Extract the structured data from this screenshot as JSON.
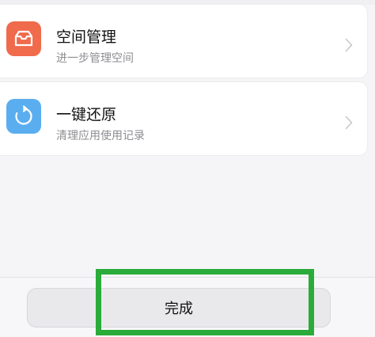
{
  "items": [
    {
      "title": "空间管理",
      "subtitle": "进一步管理空间",
      "icon": "storage-tray-icon",
      "icon_color": "#f06a4c"
    },
    {
      "title": "一键还原",
      "subtitle": "清理应用使用记录",
      "icon": "restore-refresh-icon",
      "icon_color": "#5aaef0"
    }
  ],
  "footer": {
    "done_label": "完成"
  },
  "colors": {
    "highlight": "#2aab3a"
  }
}
